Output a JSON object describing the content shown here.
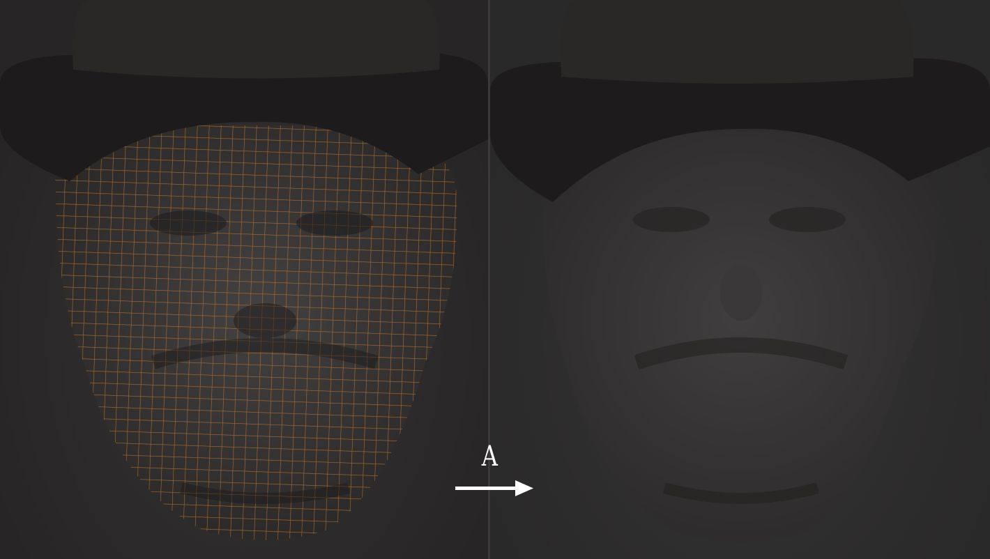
{
  "panels": [
    {
      "name": "wireframe-mesh-view",
      "mesh_color": "#c07a2a"
    },
    {
      "name": "sculpted-polypaint-view"
    }
  ],
  "annotation": {
    "label": "A",
    "arrow": "right-arrow-icon"
  },
  "colors": {
    "background": "#2b2a2a",
    "skin": "#3a3838",
    "hat": "#1e1c1c",
    "mesh": "#c07a2a",
    "label": "#ffffff"
  }
}
